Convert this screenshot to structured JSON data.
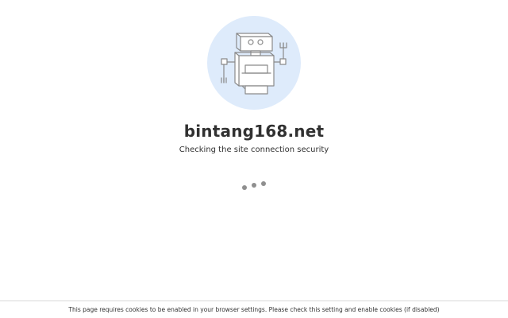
{
  "header": {
    "site_name": "bintang168.net",
    "status_message": "Checking the site connection security"
  },
  "illustration": {
    "icon": "robot-icon",
    "background_color": "#deebfb",
    "stroke_color": "#8a8a8a"
  },
  "loader": {
    "icon": "loading-dots-icon",
    "dot_color": "#8f8f8f"
  },
  "footer": {
    "notice": "This page requires cookies to be enabled in your browser settings. Please check this setting and enable cookies (if disabled)"
  }
}
